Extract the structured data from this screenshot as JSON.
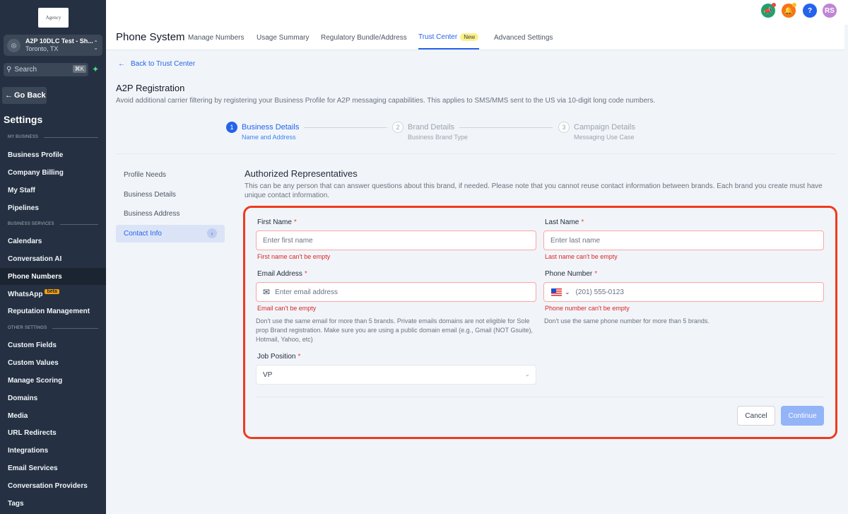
{
  "sidebar": {
    "logo": "Agency",
    "location": {
      "name": "A2P 10DLC Test - Sh...",
      "city": "Toronto, TX"
    },
    "search": {
      "placeholder": "Search",
      "shortcut": "⌘K"
    },
    "go_back": "Go Back",
    "settings_title": "Settings",
    "sections": {
      "my_business": "MY BUSINESS",
      "business_services": "BUSINESS SERVICES",
      "other_settings": "OTHER SETTINGS"
    },
    "items": [
      "Business Profile",
      "Company Billing",
      "My Staff",
      "Pipelines",
      "Calendars",
      "Conversation AI",
      "Phone Numbers",
      "WhatsApp",
      "Reputation Management",
      "Custom Fields",
      "Custom Values",
      "Manage Scoring",
      "Domains",
      "Media",
      "URL Redirects",
      "Integrations",
      "Email Services",
      "Conversation Providers",
      "Tags"
    ],
    "beta_badge": "beta"
  },
  "topbar": {
    "avatar_initials": "RS",
    "colors": {
      "megaphone": "#22a06b",
      "bell": "#f97316",
      "help": "#2563eb",
      "avatar": "#c084d6"
    }
  },
  "subnav": {
    "title": "Phone System",
    "tabs": [
      "Manage Numbers",
      "Usage Summary",
      "Regulatory Bundle/Address",
      "Trust Center",
      "Advanced Settings"
    ],
    "new_badge": "New"
  },
  "main": {
    "back_link": "Back to Trust Center",
    "title": "A2P Registration",
    "description": "Avoid additional carrier filtering by registering your Business Profile for A2P messaging capabilities. This applies to SMS/MMS sent to the US via 10-digit long code numbers.",
    "steps": [
      {
        "num": "1",
        "title": "Business Details",
        "sub": "Name and Address"
      },
      {
        "num": "2",
        "title": "Brand Details",
        "sub": "Business Brand Type"
      },
      {
        "num": "3",
        "title": "Campaign Details",
        "sub": "Messaging Use Case"
      }
    ],
    "side_menu": [
      "Profile Needs",
      "Business Details",
      "Business Address",
      "Contact Info"
    ],
    "section_title": "Authorized Representatives",
    "section_desc": "This can be any person that can answer questions about this brand, if needed. Please note that you cannot reuse contact information between brands. Each brand you create must have unique contact information."
  },
  "form": {
    "first_name": {
      "label": "First Name",
      "placeholder": "Enter first name",
      "error": "First name can't be empty"
    },
    "last_name": {
      "label": "Last Name",
      "placeholder": "Enter last name",
      "error": "Last name can't be empty"
    },
    "email": {
      "label": "Email Address",
      "placeholder": "Enter email address",
      "error": "Email can't be empty",
      "help": "Don't use the same email for more than 5 brands. Private emails domains are not eligible for Sole prop Brand registration. Make sure you are using a public domain email (e.g., Gmail (NOT Gsuite), Hotmail, Yahoo, etc)"
    },
    "phone": {
      "label": "Phone Number",
      "placeholder": "(201) 555-0123",
      "error": "Phone number can't be empty",
      "help": "Don't use the same phone number for more than 5 brands."
    },
    "job_position": {
      "label": "Job Position",
      "value": "VP"
    },
    "required_mark": "*",
    "cancel": "Cancel",
    "continue": "Continue"
  }
}
